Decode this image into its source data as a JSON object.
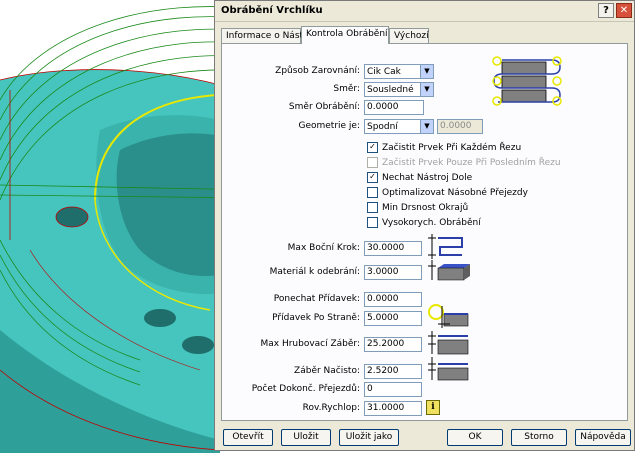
{
  "dialog": {
    "title": "Obrábění Vrchlíku",
    "help_glyph": "?",
    "close_glyph": "✕"
  },
  "tabs": [
    {
      "label": "Informace o Nástroji"
    },
    {
      "label": "Kontrola Obrábění"
    },
    {
      "label": "Výchozí"
    }
  ],
  "form": {
    "zarovnani_label": "Způsob Zarovnání:",
    "zarovnani_value": "Cik Cak",
    "smer_label": "Směr:",
    "smer_value": "Sousledné",
    "smer_obrabeni_label": "Směr Obrábění:",
    "smer_obrabeni_value": "0.0000",
    "geometrie_label": "Geometrie je:",
    "geometrie_value": "Spodní",
    "geometrie_extra_value": "0.0000",
    "checkboxes": [
      {
        "label": "Začistit Prvek Při Každém Řezu",
        "checked": true,
        "enabled": true
      },
      {
        "label": "Začistit Prvek Pouze Při Posledním Řezu",
        "checked": false,
        "enabled": false
      },
      {
        "label": "Nechat Nástroj Dole",
        "checked": true,
        "enabled": true
      },
      {
        "label": "Optimalizovat Násobné Přejezdy",
        "checked": false,
        "enabled": true
      },
      {
        "label": "Min Drsnost Okrajů",
        "checked": false,
        "enabled": true
      },
      {
        "label": "Vysokorych. Obrábění",
        "checked": false,
        "enabled": true
      }
    ],
    "max_bocni_label": "Max Boční Krok:",
    "max_bocni_value": "30.0000",
    "material_label": "Materiál k odebrání:",
    "material_value": "3.0000",
    "ponechat_label": "Ponechat Přídavek:",
    "ponechat_value": "0.0000",
    "pridavek_strane_label": "Přídavek Po Straně:",
    "pridavek_strane_value": "5.0000",
    "max_hrub_label": "Max Hrubovací Záběr:",
    "max_hrub_value": "25.2000",
    "zaber_nacisto_label": "Záběr Načisto:",
    "zaber_nacisto_value": "2.5200",
    "pocet_label": "Počet Dokonč. Přejezdů:",
    "pocet_value": "0",
    "rov_label": "Rov.Rychlop:",
    "rov_value": "31.0000",
    "info_glyph": "i"
  },
  "buttons": {
    "otevrit": "Otevřít",
    "ulozit": "Uložit",
    "ulozit_jako": "Uložit jako",
    "ok": "OK",
    "storno": "Storno",
    "napoveda": "Nápověda"
  },
  "colors": {
    "part_fill": "#46c4be",
    "part_dark": "#2a8f8b",
    "toolpath_green": "#1a8a1a",
    "edge_red": "#c00000",
    "highlight_yellow": "#e8e800",
    "icon_blue": "#2b3fa8"
  }
}
